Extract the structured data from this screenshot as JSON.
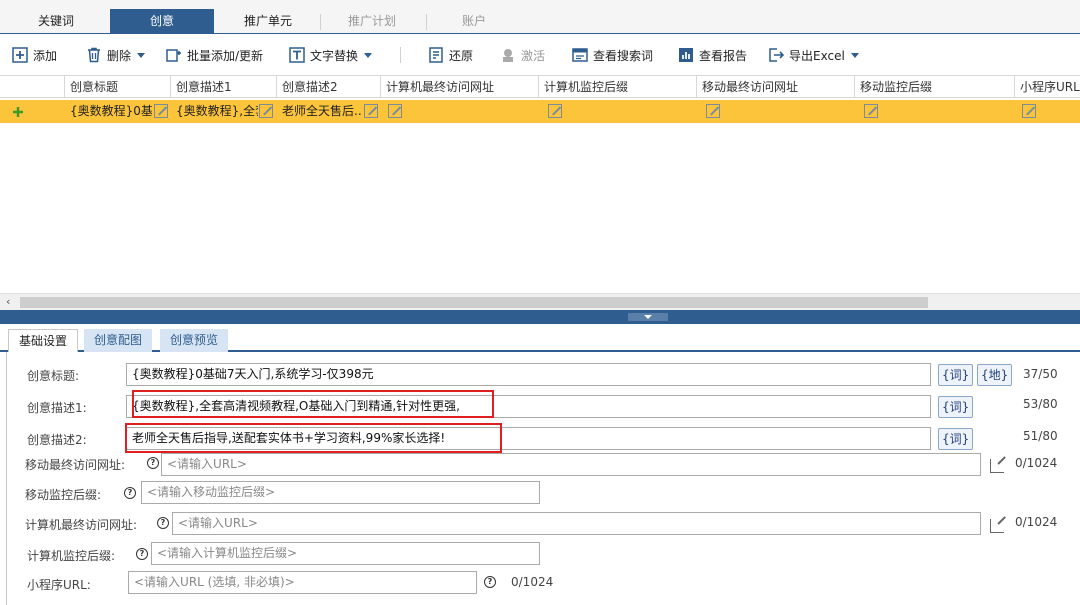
{
  "top_tabs": [
    {
      "label": "关键词",
      "state": "normal"
    },
    {
      "label": "创意",
      "state": "active"
    },
    {
      "label": "推广单元",
      "state": "normal"
    },
    {
      "label": "推广计划",
      "state": "disabled"
    },
    {
      "label": "账户",
      "state": "disabled"
    }
  ],
  "toolbar": {
    "add": "添加",
    "delete": "删除",
    "batch_add": "批量添加/更新",
    "text_replace": "文字替换",
    "restore": "还原",
    "activate": "激活",
    "view_search_terms": "查看搜索词",
    "view_report": "查看报告",
    "export_excel": "导出Excel"
  },
  "grid": {
    "columns": [
      "创意标题",
      "创意描述1",
      "创意描述2",
      "计算机最终访问网址",
      "计算机监控后缀",
      "移动最终访问网址",
      "移动监控后缀",
      "小程序URL"
    ],
    "row": {
      "title": "{奥数教程}0基...",
      "desc1": "{奥数教程},全套...",
      "desc2": "老师全天售后..."
    }
  },
  "sub_tabs": [
    "基础设置",
    "创意配图",
    "创意预览"
  ],
  "form": {
    "title_label": "创意标题:",
    "title_value": "{奥数教程}0基础7天入门,系统学习-仅398元",
    "title_count": "37/50",
    "desc1_label": "创意描述1:",
    "desc1_value": "{奥数教程},全套高清视频教程,O基础入门到精通,针对性更强,",
    "desc1_count": "53/80",
    "desc2_label": "创意描述2:",
    "desc2_value": "老师全天售后指导,送配套实体书+学习资料,99%家长选择!",
    "desc2_count": "51/80",
    "word_btn": "{词}",
    "place_btn": "{地}",
    "mobile_url_label": "移动最终访问网址:",
    "mobile_url_placeholder": "<请输入URL>",
    "mobile_url_count": "0/1024",
    "mobile_suffix_label": "移动监控后缀:",
    "mobile_suffix_placeholder": "<请输入移动监控后缀>",
    "pc_url_label": "计算机最终访问网址:",
    "pc_url_placeholder": "<请输入URL>",
    "pc_url_count": "0/1024",
    "pc_suffix_label": "计算机监控后缀:",
    "pc_suffix_placeholder": "<请输入计算机监控后缀>",
    "mini_url_label": "小程序URL:",
    "mini_url_placeholder": "<请输入URL (选填, 非必填)>",
    "mini_url_count": "0/1024",
    "help_glyph": "?"
  },
  "colors": {
    "accent": "#2f5d8f",
    "row_highlight": "#fcc43b",
    "annotation_red": "#e02020"
  }
}
